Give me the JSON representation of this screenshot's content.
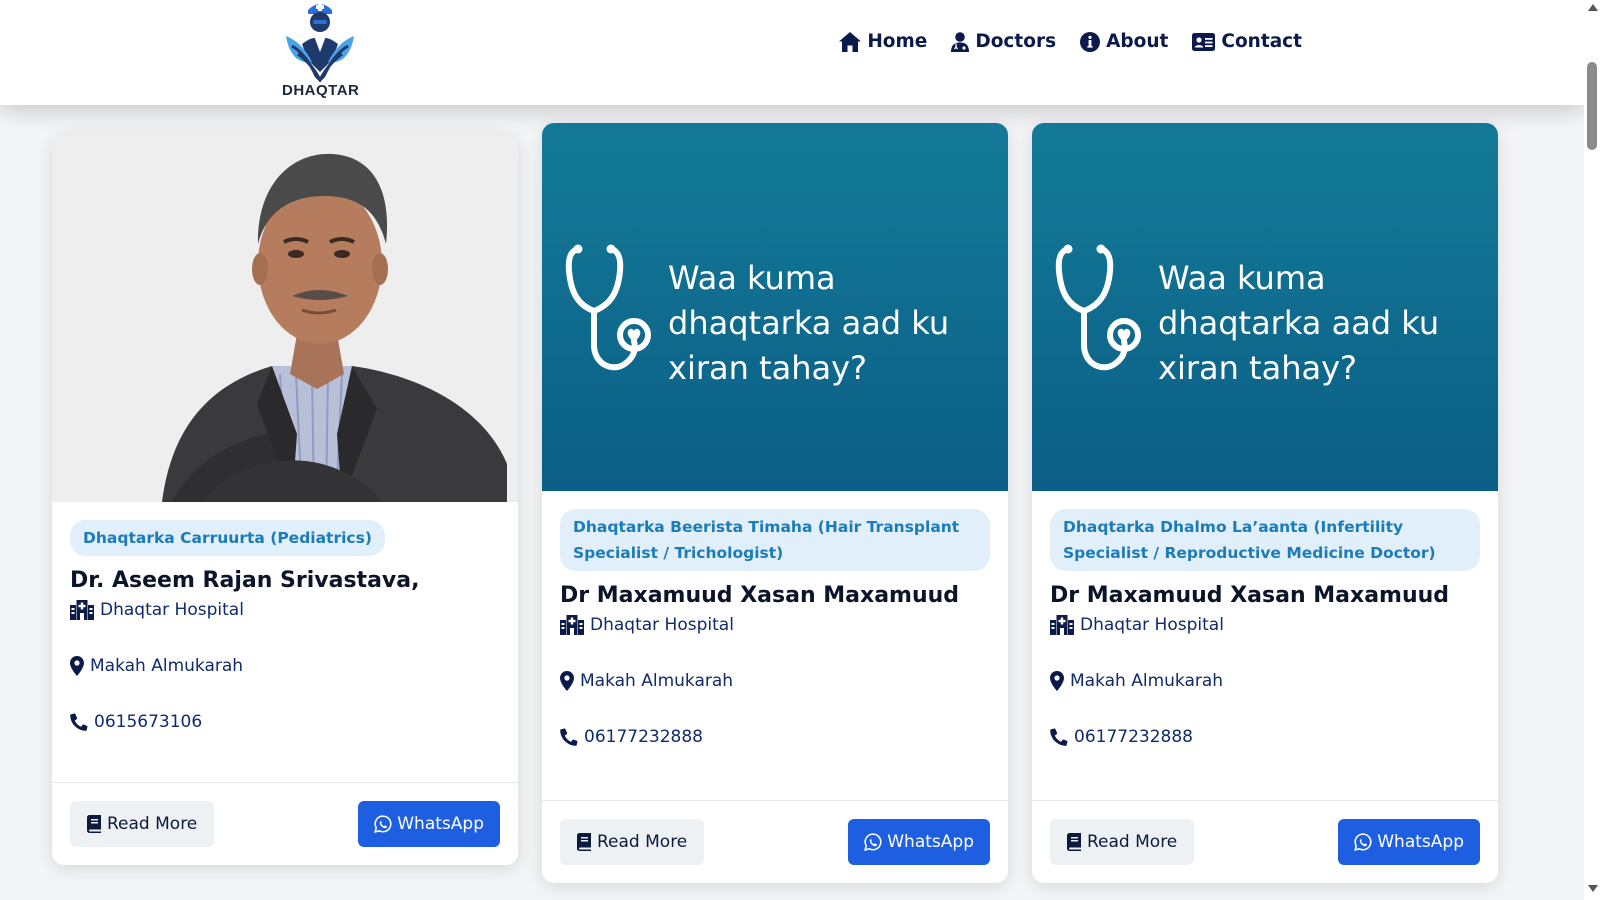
{
  "header": {
    "logo_text": "DHAQTAR",
    "nav": [
      {
        "label": "Home",
        "icon": "home-icon"
      },
      {
        "label": "Doctors",
        "icon": "doctor-icon"
      },
      {
        "label": "About",
        "icon": "info-icon"
      },
      {
        "label": "Contact",
        "icon": "contact-card-icon"
      }
    ]
  },
  "colors": {
    "brand_blue": "#1d5fe0",
    "banner_teal": "#0b5e86",
    "specialty_bg": "#e0eff9",
    "specialty_text": "#1c7bb8",
    "nav_text": "#0b1a4a"
  },
  "cards": [
    {
      "image": "doctor-photo",
      "specialty": "Dhaqtarka Carruurta (Pediatrics)",
      "name": "Dr. Aseem Rajan Srivastava,",
      "hospital": "Dhaqtar Hospital",
      "location": "Makah Almukarah",
      "phone": "0615673106",
      "read_more": "Read More",
      "whatsapp": "WhatsApp"
    },
    {
      "image": "stethoscope-placeholder",
      "banner_text": "Waa kuma dhaqtarka aad ku xiran tahay?",
      "specialty": "Dhaqtarka Beerista Timaha (Hair Transplant Specialist / Trichologist)",
      "name": "Dr Maxamuud Xasan Maxamuud",
      "hospital": "Dhaqtar Hospital",
      "location": "Makah Almukarah",
      "phone": "06177232888",
      "read_more": "Read More",
      "whatsapp": "WhatsApp"
    },
    {
      "image": "stethoscope-placeholder",
      "banner_text": "Waa kuma dhaqtarka aad ku xiran tahay?",
      "specialty": "Dhaqtarka Dhalmo La’aanta (Infertility Specialist / Reproductive Medicine Doctor)",
      "name": "Dr Maxamuud Xasan Maxamuud",
      "hospital": "Dhaqtar Hospital",
      "location": "Makah Almukarah",
      "phone": "06177232888",
      "read_more": "Read More",
      "whatsapp": "WhatsApp"
    }
  ]
}
